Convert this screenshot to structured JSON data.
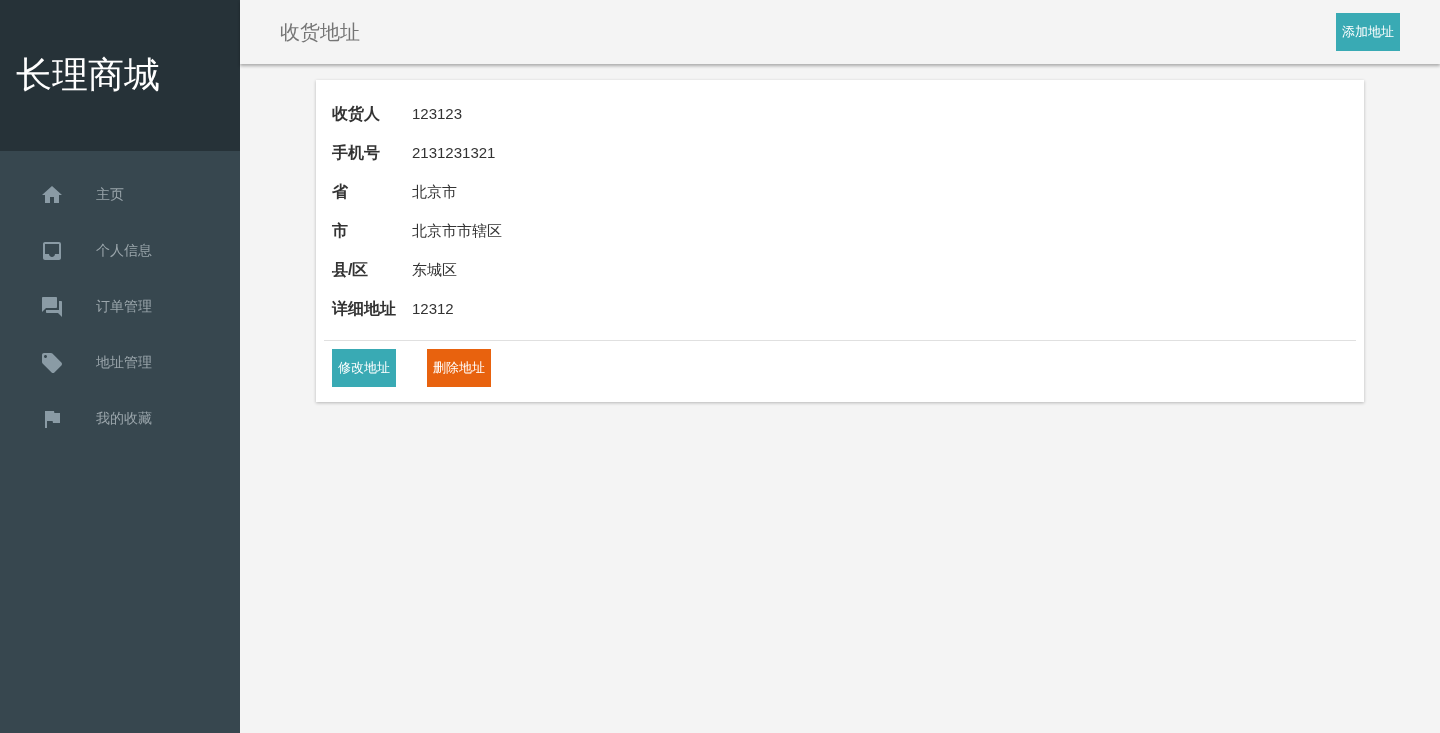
{
  "sidebar": {
    "logo": "长理商城",
    "items": [
      {
        "label": "主页"
      },
      {
        "label": "个人信息"
      },
      {
        "label": "订单管理"
      },
      {
        "label": "地址管理"
      },
      {
        "label": "我的收藏"
      }
    ]
  },
  "header": {
    "title": "收货地址",
    "add_button": "添加地址"
  },
  "address_card": {
    "fields": [
      {
        "label": "收货人",
        "value": "123123"
      },
      {
        "label": "手机号",
        "value": "2131231321"
      },
      {
        "label": "省",
        "value": "北京市"
      },
      {
        "label": "市",
        "value": "北京市市辖区"
      },
      {
        "label": "县/区",
        "value": "东城区"
      },
      {
        "label": "详细地址",
        "value": "12312"
      }
    ],
    "actions": [
      {
        "kind": "edit",
        "label": "修改地址"
      },
      {
        "kind": "delete",
        "label": "删除地址"
      }
    ]
  }
}
